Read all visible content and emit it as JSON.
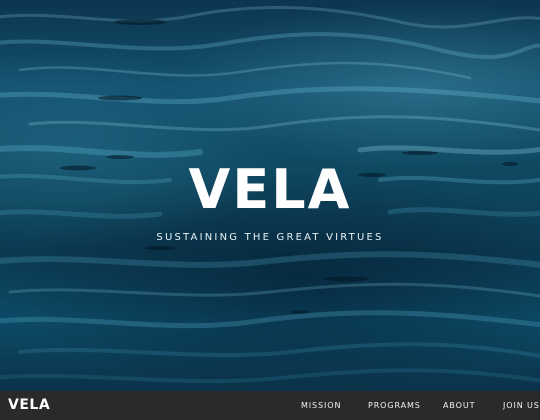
{
  "hero": {
    "title": "VELA",
    "tagline": "SUSTAINING THE GREAT VIRTUES"
  },
  "navbar": {
    "logo": "VELA",
    "links": [
      {
        "label": "MISSION"
      },
      {
        "label": "PROGRAMS"
      },
      {
        "label": "ABOUT"
      },
      {
        "label": "JOIN US"
      }
    ]
  },
  "colors": {
    "nav_background": "#2a2a2a",
    "water_dark": "#0b2b3f",
    "water_mid": "#13506d",
    "text": "#ffffff"
  }
}
